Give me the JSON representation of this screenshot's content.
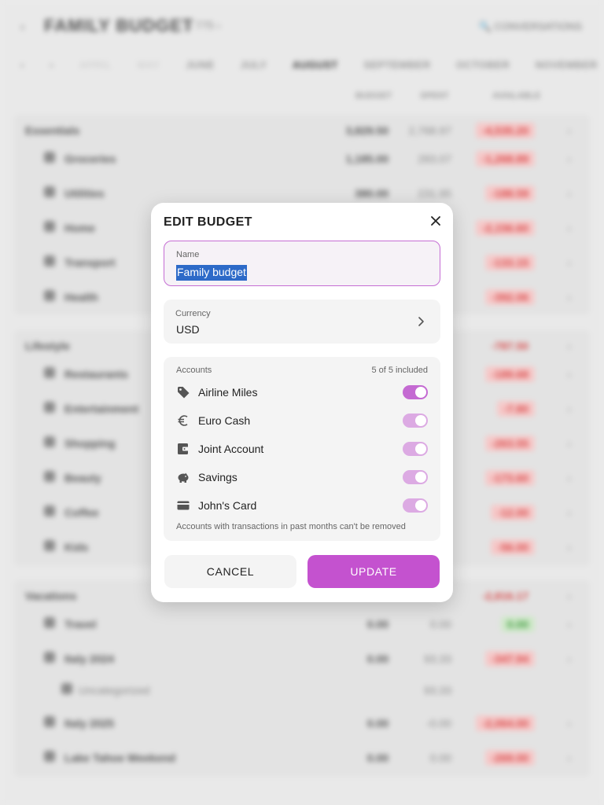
{
  "background": {
    "title": "FAMILY BUDGET",
    "year": "‹  775  ›",
    "search": "🔍 CONVERSATIONS",
    "months": [
      "APRIL",
      "MAY",
      "JUNE",
      "JULY",
      "AUGUST",
      "SEPTEMBER",
      "OCTOBER",
      "NOVEMBER"
    ],
    "active_month": "AUGUST",
    "col_budget": "BUDGET",
    "col_spent": "SPENT",
    "col_available": "AVAILABLE",
    "groups": {
      "essentials": "Essentials",
      "lifestyle": "Lifestyle",
      "vacations": "Vacations"
    },
    "rows": {
      "ess_total": {
        "budget": "3,829.50",
        "spent": "2,768.97",
        "avail": "-4,535.20"
      },
      "groceries": {
        "label": "Groceries",
        "budget": "1,185.00",
        "spent": "283.07",
        "avail": "-1,268.89"
      },
      "utilities": {
        "label": "Utilities",
        "budget": "380.00",
        "spent": "231.95",
        "avail": "-188.59"
      },
      "home": {
        "label": "Home",
        "avail": "-2,156.60"
      },
      "transport": {
        "label": "Transport",
        "avail": "-133.15"
      },
      "health": {
        "label": "Health",
        "avail": "-392.06"
      },
      "life_total": {
        "avail": "-787.50"
      },
      "restaurants": {
        "label": "Restaurants",
        "avail": "-189.68"
      },
      "entertainment": {
        "label": "Entertainment",
        "avail": "-7.80"
      },
      "shopping": {
        "label": "Shopping",
        "avail": "-263.55"
      },
      "beauty": {
        "label": "Beauty",
        "avail": "-173.60"
      },
      "coffee": {
        "label": "Coffee",
        "avail": "-12.00"
      },
      "kids": {
        "label": "Kids",
        "avail": "-56.00"
      },
      "vac_total": {
        "avail": "-2,816.17"
      },
      "travel": {
        "label": "Travel",
        "budget": "0.00",
        "spent": "0.00",
        "avail": "0.00"
      },
      "italy": {
        "label": "Italy 2024",
        "budget": "0.00",
        "spent": "93.33",
        "avail": "-347.94"
      },
      "uncategorized": {
        "label": "Uncategorized",
        "spent": "93.33"
      },
      "italy2": {
        "label": "Italy 2025",
        "budget": "0.00",
        "spent": "-0.00",
        "avail": "-2,064.00"
      },
      "tahoe": {
        "label": "Lake Tahoe Weekend",
        "budget": "0.00",
        "spent": "0.00",
        "avail": "-269.00"
      }
    }
  },
  "dialog": {
    "title": "EDIT BUDGET",
    "name_label": "Name",
    "name_value": "Family budget",
    "currency_label": "Currency",
    "currency_value": "USD",
    "accounts_label": "Accounts",
    "accounts_count": "5 of 5 included",
    "accounts": [
      {
        "name": "Airline Miles",
        "icon": "tag-icon",
        "enabled": true
      },
      {
        "name": "Euro Cash",
        "icon": "euro-icon",
        "enabled": true
      },
      {
        "name": "Joint Account",
        "icon": "wallet-icon",
        "enabled": true
      },
      {
        "name": "Savings",
        "icon": "piggy-bank-icon",
        "enabled": true
      },
      {
        "name": "John's Card",
        "icon": "credit-card-icon",
        "enabled": true
      }
    ],
    "accounts_note": "Accounts with transactions in past months can't be removed",
    "cancel_label": "CANCEL",
    "update_label": "UPDATE"
  },
  "colors": {
    "accent": "#c452cf",
    "accent_light": "#dcaae3",
    "selection": "#2d6ac8"
  }
}
